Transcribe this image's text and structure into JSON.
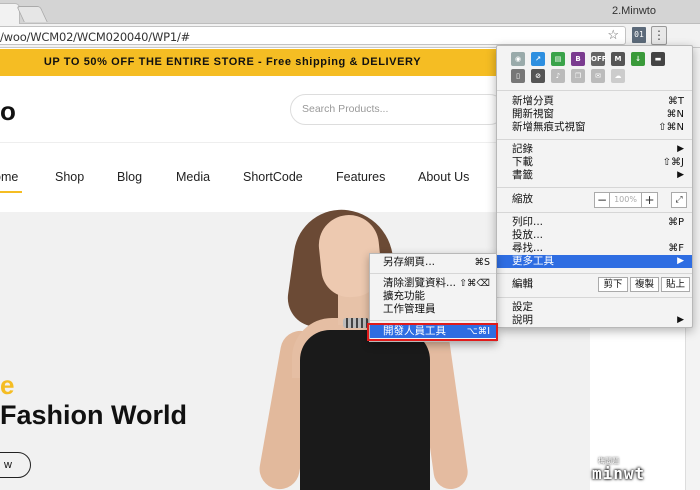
{
  "browser": {
    "tab_close_glyph": "×",
    "profile_name": "2.Minwto",
    "url": "/woo/WCM02/WCM020040/WP1/#",
    "ext_badge": "01",
    "menu_glyph": "⋮",
    "star_glyph": "☆"
  },
  "site": {
    "promo": "UP TO 50% OFF THE ENTIRE STORE - Free shipping & DELIVERY",
    "logo_fragment": "o",
    "search_placeholder": "Search Products...",
    "nav": [
      "ome",
      "Shop",
      "Blog",
      "Media",
      "ShortCode",
      "Features",
      "About Us"
    ],
    "hero_kicker": "e",
    "hero_title": "Fashion World",
    "hero_button": "w"
  },
  "chrome_menu": {
    "items": {
      "new_tab": "新增分頁",
      "new_tab_sc": "⌘T",
      "new_window": "開新視窗",
      "new_window_sc": "⌘N",
      "incognito": "新增無痕式視窗",
      "incognito_sc": "⇧⌘N",
      "history": "記錄",
      "downloads": "下載",
      "downloads_sc": "⇧⌘J",
      "bookmarks": "書籤",
      "zoom": "縮放",
      "zoom_value": "100%",
      "zoom_minus": "−",
      "zoom_plus": "+",
      "print": "列印...",
      "print_sc": "⌘P",
      "cast": "投放...",
      "find": "尋找...",
      "find_sc": "⌘F",
      "more_tools": "更多工具",
      "edit": "編輯",
      "cut": "剪下",
      "copy": "複製",
      "paste": "貼上",
      "settings": "設定",
      "help": "說明"
    },
    "submenu": {
      "save_page": "另存網頁...",
      "save_page_sc": "⌘S",
      "clear_data": "清除瀏覽資料...",
      "clear_data_sc": "⇧⌘⌫",
      "extensions": "擴充功能",
      "task_manager": "工作管理員",
      "dev_tools": "開發人員工具",
      "dev_tools_sc": "⌥⌘I"
    }
  },
  "watermark": {
    "main": "minwt",
    "sub": "梅問題"
  },
  "colors": {
    "accent": "#f5bd23",
    "menu_highlight": "#2e6de2",
    "callout": "#e01b1b"
  }
}
